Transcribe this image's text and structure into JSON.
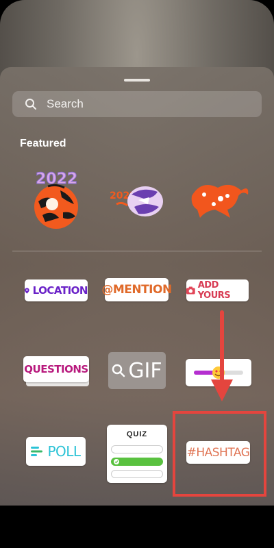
{
  "search": {
    "placeholder": "Search"
  },
  "sections": {
    "featured": "Featured"
  },
  "featured_stickers": [
    {
      "name": "2022 tiger sticker",
      "text": "2022"
    },
    {
      "name": "roaring tiger sticker",
      "text": "2022"
    },
    {
      "name": "leaping tiger sticker"
    }
  ],
  "stickers": {
    "location": "LOCATION",
    "mention": "@MENTION",
    "add_yours": "ADD YOURS",
    "questions": "QUESTIONS",
    "gif": "GIF",
    "poll": "POLL",
    "quiz": "QUIZ",
    "hashtag": "#HASHTAG"
  },
  "colors": {
    "highlight": "#e4453e",
    "location": "#6a22c8",
    "poll": "#2bc3d6",
    "quiz_correct": "#59c13f"
  },
  "icons": [
    "search-icon",
    "location-pin-icon",
    "camera-icon",
    "magnifier-icon",
    "heart-eyes-emoji-icon",
    "poll-lines-icon",
    "check-icon",
    "arrow-down-icon"
  ]
}
